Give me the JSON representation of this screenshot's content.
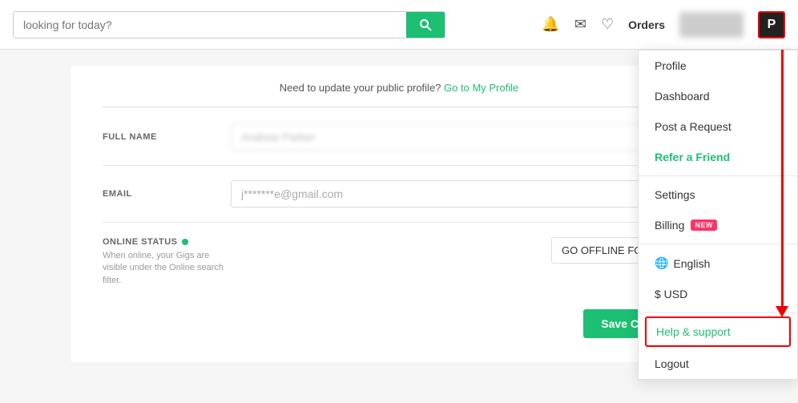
{
  "header": {
    "search_placeholder": "looking for today?",
    "search_icon": "🔍",
    "orders_label": "Orders",
    "profile_initial": "P"
  },
  "notice": {
    "text": "Need to update your public profile?",
    "link_text": "Go to My Profile"
  },
  "form": {
    "full_name_label": "FULL NAME",
    "full_name_placeholder": "Andrew Parker",
    "email_label": "EMAIL",
    "email_value": "j*******e@gmail.com",
    "online_status_label": "ONLINE STATUS",
    "online_desc": "When online, your Gigs are visible under the Online search filter.",
    "offline_option": "GO OFFLINE FOR...",
    "save_label": "Save Changes"
  },
  "dropdown": {
    "items": [
      {
        "id": "profile",
        "label": "Profile",
        "type": "normal"
      },
      {
        "id": "dashboard",
        "label": "Dashboard",
        "type": "normal"
      },
      {
        "id": "post-request",
        "label": "Post a Request",
        "type": "normal"
      },
      {
        "id": "refer-friend",
        "label": "Refer a Friend",
        "type": "green"
      },
      {
        "id": "settings",
        "label": "Settings",
        "type": "normal"
      },
      {
        "id": "billing",
        "label": "Billing",
        "type": "badge",
        "badge": "NEW"
      },
      {
        "id": "english",
        "label": "English",
        "type": "lang"
      },
      {
        "id": "usd",
        "label": "$ USD",
        "type": "normal"
      },
      {
        "id": "help",
        "label": "Help & support",
        "type": "highlighted"
      },
      {
        "id": "logout",
        "label": "Logout",
        "type": "normal"
      }
    ]
  }
}
